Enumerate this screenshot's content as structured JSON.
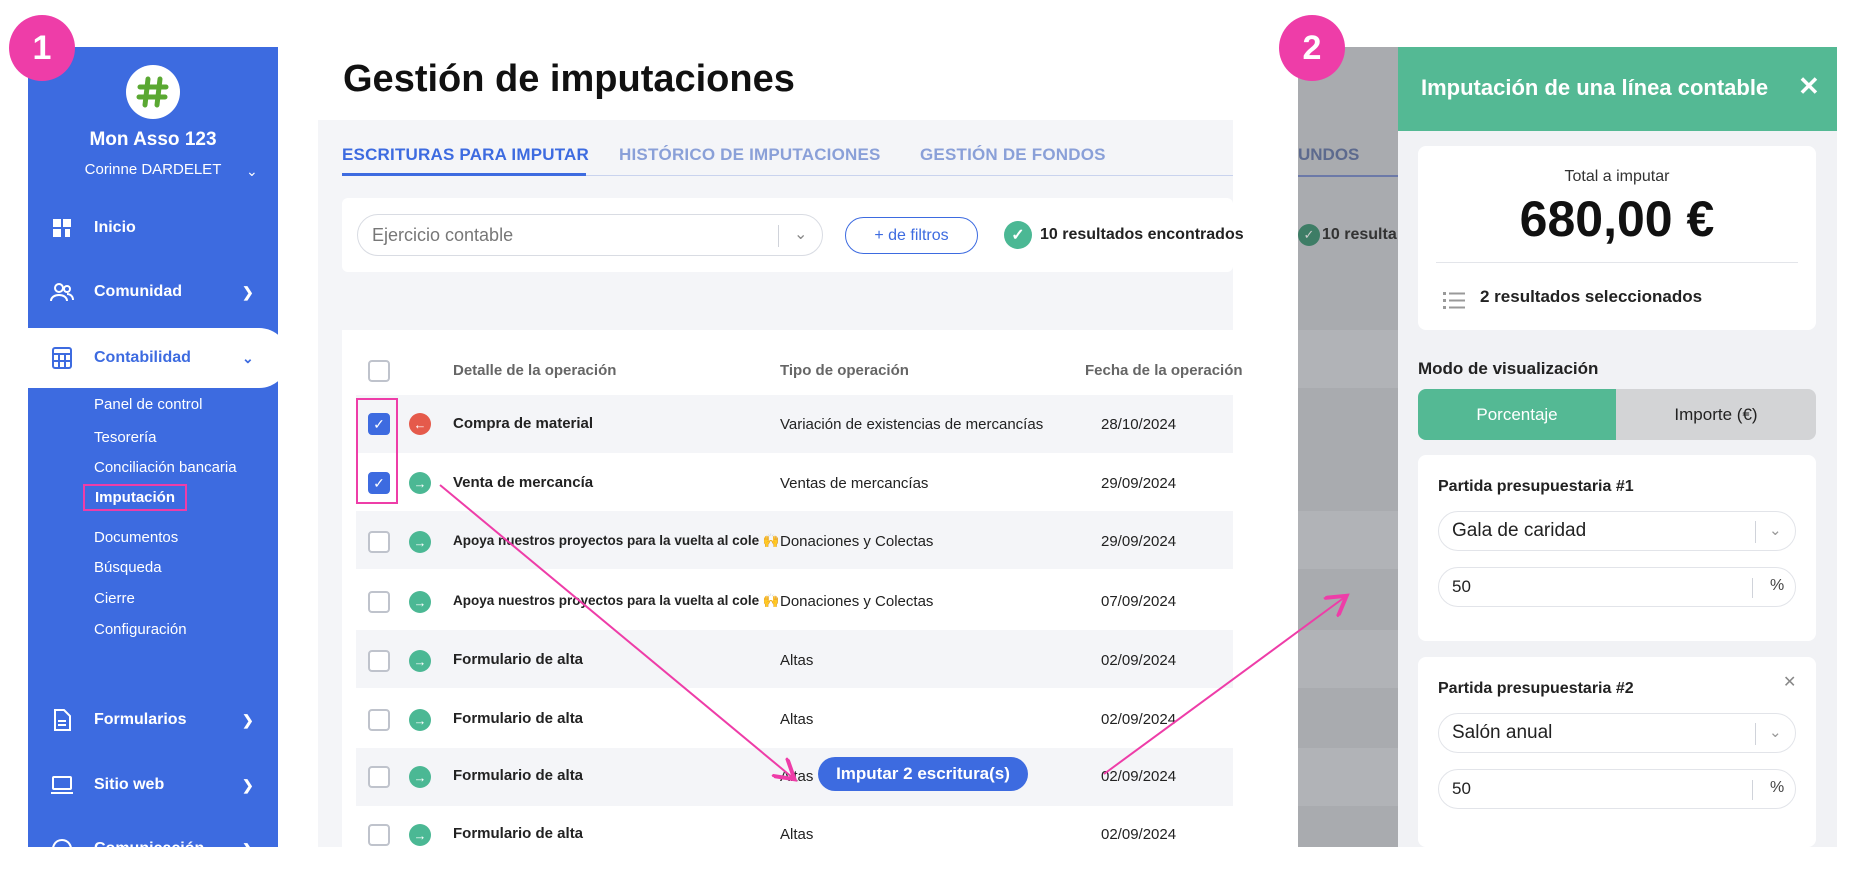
{
  "badges": {
    "step1": "1",
    "step2": "2"
  },
  "sidebar": {
    "org_name": "Mon Asso 123",
    "user_name": "Corinne DARDELET",
    "nav": [
      {
        "label": "Inicio",
        "icon": "dashboard-icon"
      },
      {
        "label": "Comunidad",
        "icon": "users-icon"
      },
      {
        "label": "Contabilidad",
        "icon": "calculator-icon"
      },
      {
        "label": "Formularios",
        "icon": "document-icon"
      },
      {
        "label": "Sitio web",
        "icon": "laptop-icon"
      },
      {
        "label": "Comunicación",
        "icon": "chat-icon"
      }
    ],
    "subnav": [
      "Panel de control",
      "Tesorería",
      "Conciliación bancaria",
      "Imputación",
      "Documentos",
      "Búsqueda",
      "Cierre",
      "Configuración"
    ]
  },
  "main": {
    "title": "Gestión de imputaciones",
    "tabs": [
      "ESCRITURAS PARA IMPUTAR",
      "HISTÓRICO DE IMPUTACIONES",
      "GESTIÓN DE FONDOS"
    ],
    "filter": {
      "placeholder": "Ejercicio contable",
      "more_filters": "+ de filtros",
      "results": "10 resultados encontrados"
    },
    "table": {
      "headers": [
        "Detalle de la operación",
        "Tipo de operación",
        "Fecha de la operación"
      ],
      "rows": [
        {
          "detail": "Compra de material",
          "type": "Variación de existencias de mercancías",
          "date": "28/10/2024"
        },
        {
          "detail": "Venta de mercancía",
          "type": "Ventas de mercancías",
          "date": "29/09/2024"
        },
        {
          "detail": "Apoya nuestros proyectos para la vuelta al cole 🙌",
          "type": "Donaciones y Colectas",
          "date": "29/09/2024"
        },
        {
          "detail": "Apoya nuestros proyectos para la vuelta al cole 🙌",
          "type": "Donaciones y Colectas",
          "date": "07/09/2024"
        },
        {
          "detail": "Formulario de alta",
          "type": "Altas",
          "date": "02/09/2024"
        },
        {
          "detail": "Formulario de alta",
          "type": "Altas",
          "date": "02/09/2024"
        },
        {
          "detail": "Formulario de alta",
          "type": "Altas",
          "date": "02/09/2024"
        },
        {
          "detail": "Formulario de alta",
          "type": "Altas",
          "date": "02/09/2024"
        }
      ]
    },
    "impute_button": "Imputar 2 escritura(s)"
  },
  "overlay": {
    "tab_fragment": "UNDOS",
    "results_fragment": "10 resulta"
  },
  "panel": {
    "title": "Imputación de una línea contable",
    "total_label": "Total a imputar",
    "total_value": "680,00 €",
    "selected": "2 resultados seleccionados",
    "mode_label": "Modo de visualización",
    "mode_options": [
      "Porcentaje",
      "Importe (€)"
    ],
    "partidas": [
      {
        "title": "Partida presupuestaria #1",
        "select": "Gala de caridad",
        "value": "50",
        "unit": "%"
      },
      {
        "title": "Partida presupuestaria #2",
        "select": "Salón anual",
        "value": "50",
        "unit": "%"
      }
    ]
  },
  "colors": {
    "primary": "#3d6be0",
    "accent_green": "#54b994",
    "annotation_pink": "#ee3da8",
    "negative_red": "#e55a4b"
  }
}
